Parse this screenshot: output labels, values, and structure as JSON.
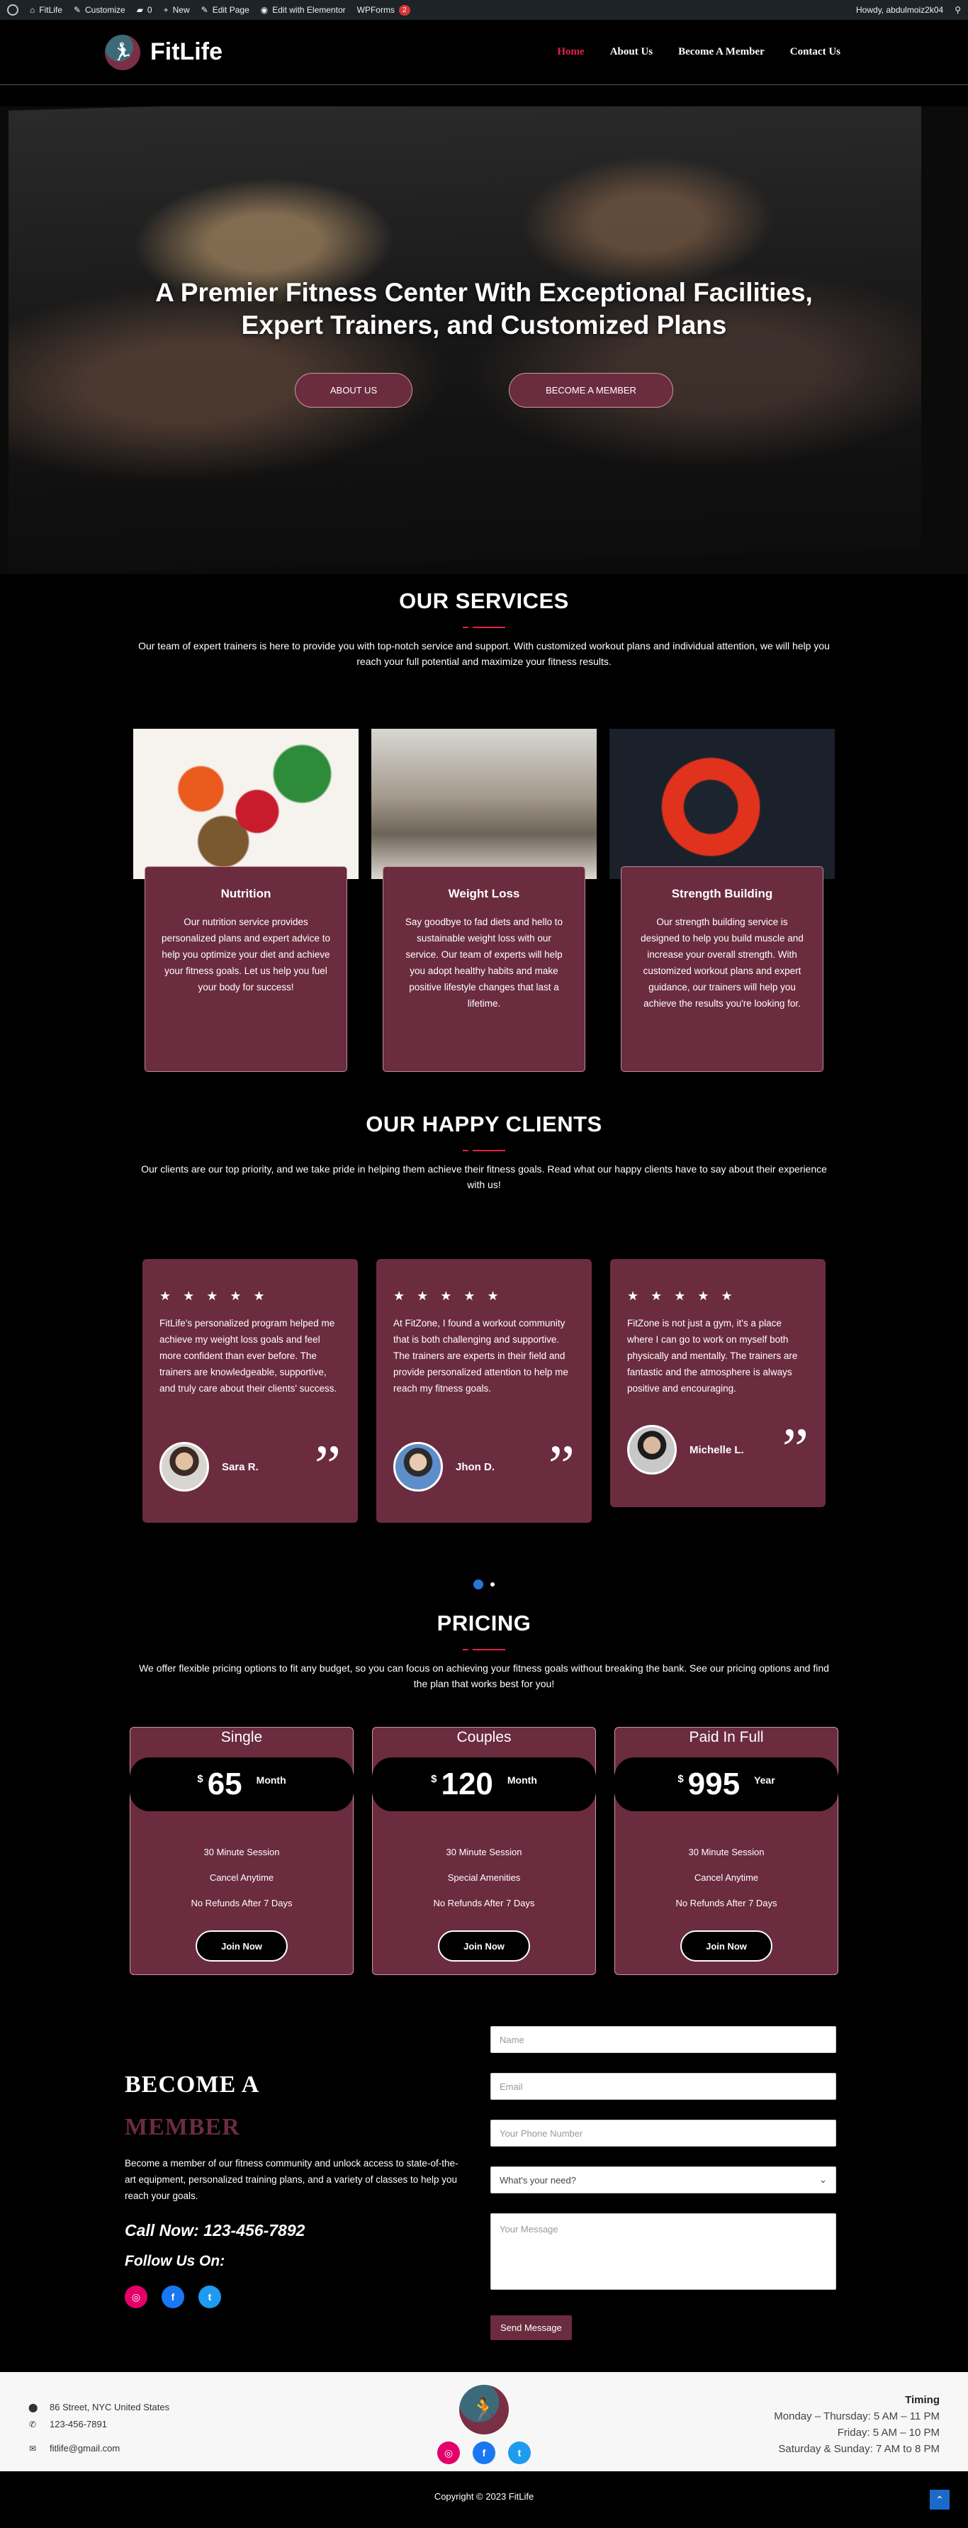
{
  "adminbar": {
    "site": "FitLife",
    "customize": "Customize",
    "comments": "0",
    "new": "New",
    "edit_page": "Edit Page",
    "elementor": "Edit with Elementor",
    "wpforms": "WPForms",
    "wpforms_badge": "2",
    "howdy": "Howdy, abdulmoiz2k04"
  },
  "header": {
    "brand": "FitLife",
    "nav": [
      "Home",
      "About Us",
      "Become A Member",
      "Contact Us"
    ]
  },
  "hero": {
    "title": "A Premier Fitness Center With Exceptional Facilities, Expert Trainers, and Customized Plans",
    "btn_about": "ABOUT US",
    "btn_member": "BECOME A MEMBER"
  },
  "services": {
    "title": "OUR SERVICES",
    "desc": "Our team of expert trainers is here to provide you with top-notch service and support. With customized workout plans and individual attention, we will help you reach your full potential and maximize your fitness results.",
    "items": [
      {
        "title": "Nutrition",
        "text": "Our nutrition service provides personalized plans and expert advice to help you optimize your diet and achieve your fitness goals. Let us help you fuel your body for success!"
      },
      {
        "title": "Weight Loss",
        "text": "Say goodbye to fad diets and hello to sustainable weight loss with our service. Our team of experts will help you adopt healthy habits and make positive lifestyle changes that last a lifetime."
      },
      {
        "title": "Strength Building",
        "text": "Our strength building service is designed to help you build muscle and increase your overall strength. With customized workout plans and expert guidance, our trainers will help you achieve the results you're looking for."
      }
    ]
  },
  "clients": {
    "title": "OUR HAPPY CLIENTS",
    "desc": "Our clients are our top priority, and we take pride in helping them achieve their fitness goals. Read what our happy clients have to say about their experience with us!",
    "stars": "★ ★ ★ ★ ★",
    "quote_glyph": "”",
    "items": [
      {
        "text": "FitLife's personalized program helped me achieve my weight loss goals and feel more confident than ever before. The trainers are knowledgeable, supportive, and truly care about their clients' success.",
        "name": "Sara R."
      },
      {
        "text": "At FitZone, I found a workout community that is both challenging and supportive. The trainers are experts in their field and provide personalized attention to help me reach my fitness goals.",
        "name": "Jhon D."
      },
      {
        "text": "FitZone is not just a gym, it's a place where I can go to work on myself both physically and mentally. The trainers are fantastic and the atmosphere is always positive and encouraging.",
        "name": "Michelle L."
      }
    ]
  },
  "pricing": {
    "title": "PRICING",
    "desc": "We offer flexible pricing options to fit any budget, so you can focus on achieving your fitness goals without breaking the bank. See our pricing options and find the plan that works best for you!",
    "currency": "$",
    "join": "Join Now",
    "plans": [
      {
        "name": "Single",
        "amount": "65",
        "period": "Month",
        "features": [
          "30 Minute Session",
          "Cancel Anytime",
          "No Refunds After 7 Days"
        ]
      },
      {
        "name": "Couples",
        "amount": "120",
        "period": "Month",
        "features": [
          "30 Minute Session",
          "Special Amenities",
          "No Refunds After 7 Days"
        ]
      },
      {
        "name": "Paid In Full",
        "amount": "995",
        "period": "Year",
        "features": [
          "30 Minute Session",
          "Cancel Anytime",
          "No Refunds After 7 Days"
        ]
      }
    ]
  },
  "member": {
    "title": "BECOME A",
    "subtitle": "MEMBER",
    "desc": "Become a member of our fitness community and unlock access to state-of-the-art equipment, personalized training plans, and a variety of classes to help you reach your goals.",
    "call": "Call Now: 123-456-7892",
    "follow": "Follow Us On:",
    "form": {
      "name_ph": "Name",
      "email_ph": "Email",
      "phone_ph": "Your Phone Number",
      "need_value": "What's your need?",
      "message_ph": "Your Message",
      "send": "Send Message"
    }
  },
  "footer": {
    "address": "86 Street, NYC United States",
    "phone": "123-456-7891",
    "email": "fitlife@gmail.com",
    "timing_title": "Timing",
    "timing": [
      "Monday – Thursday: 5 AM – 11 PM",
      "Friday: 5 AM – 10 PM",
      "Saturday & Sunday: 7 AM to 8 PM"
    ],
    "copyright": "Copyright © 2023 FitLife"
  },
  "colors": {
    "accent": "#6b2c40",
    "nav_active": "#e51f4a",
    "slider_dot": "#2a73d9"
  }
}
